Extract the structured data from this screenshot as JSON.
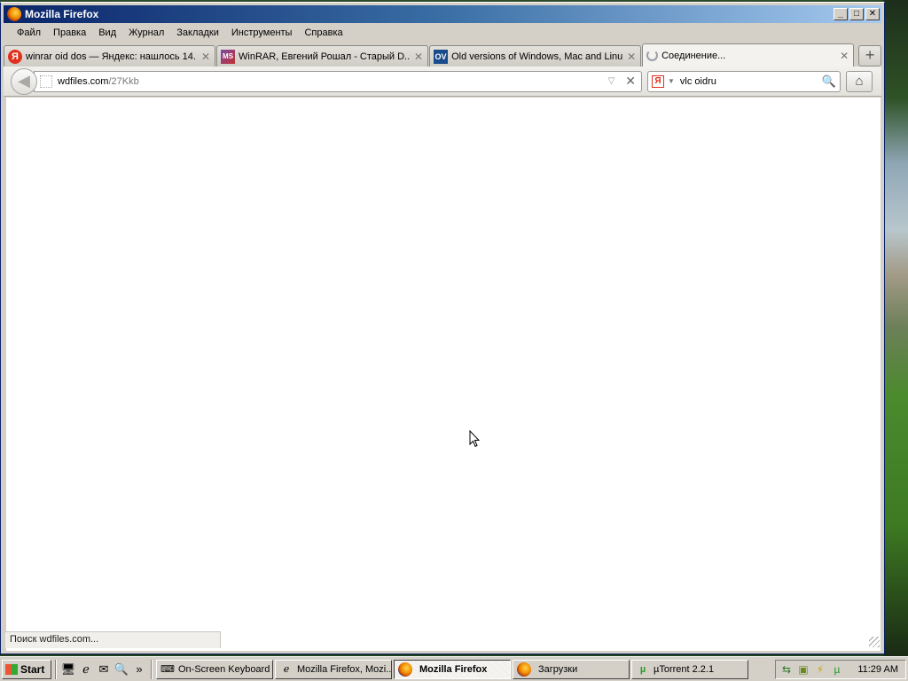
{
  "window": {
    "title": "Mozilla Firefox"
  },
  "menubar": {
    "items": [
      "Файл",
      "Правка",
      "Вид",
      "Журнал",
      "Закладки",
      "Инструменты",
      "Справка"
    ]
  },
  "tabs": [
    {
      "label": "winrar oid dos — Яндекс: нашлось 14...",
      "icon": "yandex-icon"
    },
    {
      "label": "WinRAR, Евгений Рошал - Старый D...",
      "icon": "ms-dos-icon"
    },
    {
      "label": "Old versions of Windows, Mac and Linu...",
      "icon": "oldversion-icon"
    },
    {
      "label": "Соединение...",
      "icon": "loading-icon",
      "active": true
    }
  ],
  "navbar": {
    "url_host": "wdfiles.com",
    "url_path": "/27Kkb",
    "search_text": "vlc oidru"
  },
  "status": {
    "text": "Поиск wdfiles.com..."
  },
  "taskbar": {
    "start_label": "Start",
    "tasks": [
      {
        "label": "On-Screen Keyboard",
        "icon": "keyboard-icon"
      },
      {
        "label": "Mozilla Firefox, Mozi...",
        "icon": "ie-icon"
      },
      {
        "label": "Mozilla Firefox",
        "icon": "firefox-icon",
        "active": true
      },
      {
        "label": "Загрузки",
        "icon": "firefox-icon"
      },
      {
        "label": "µTorrent 2.2.1",
        "icon": "utorrent-icon"
      }
    ],
    "clock": "11:29 AM"
  }
}
